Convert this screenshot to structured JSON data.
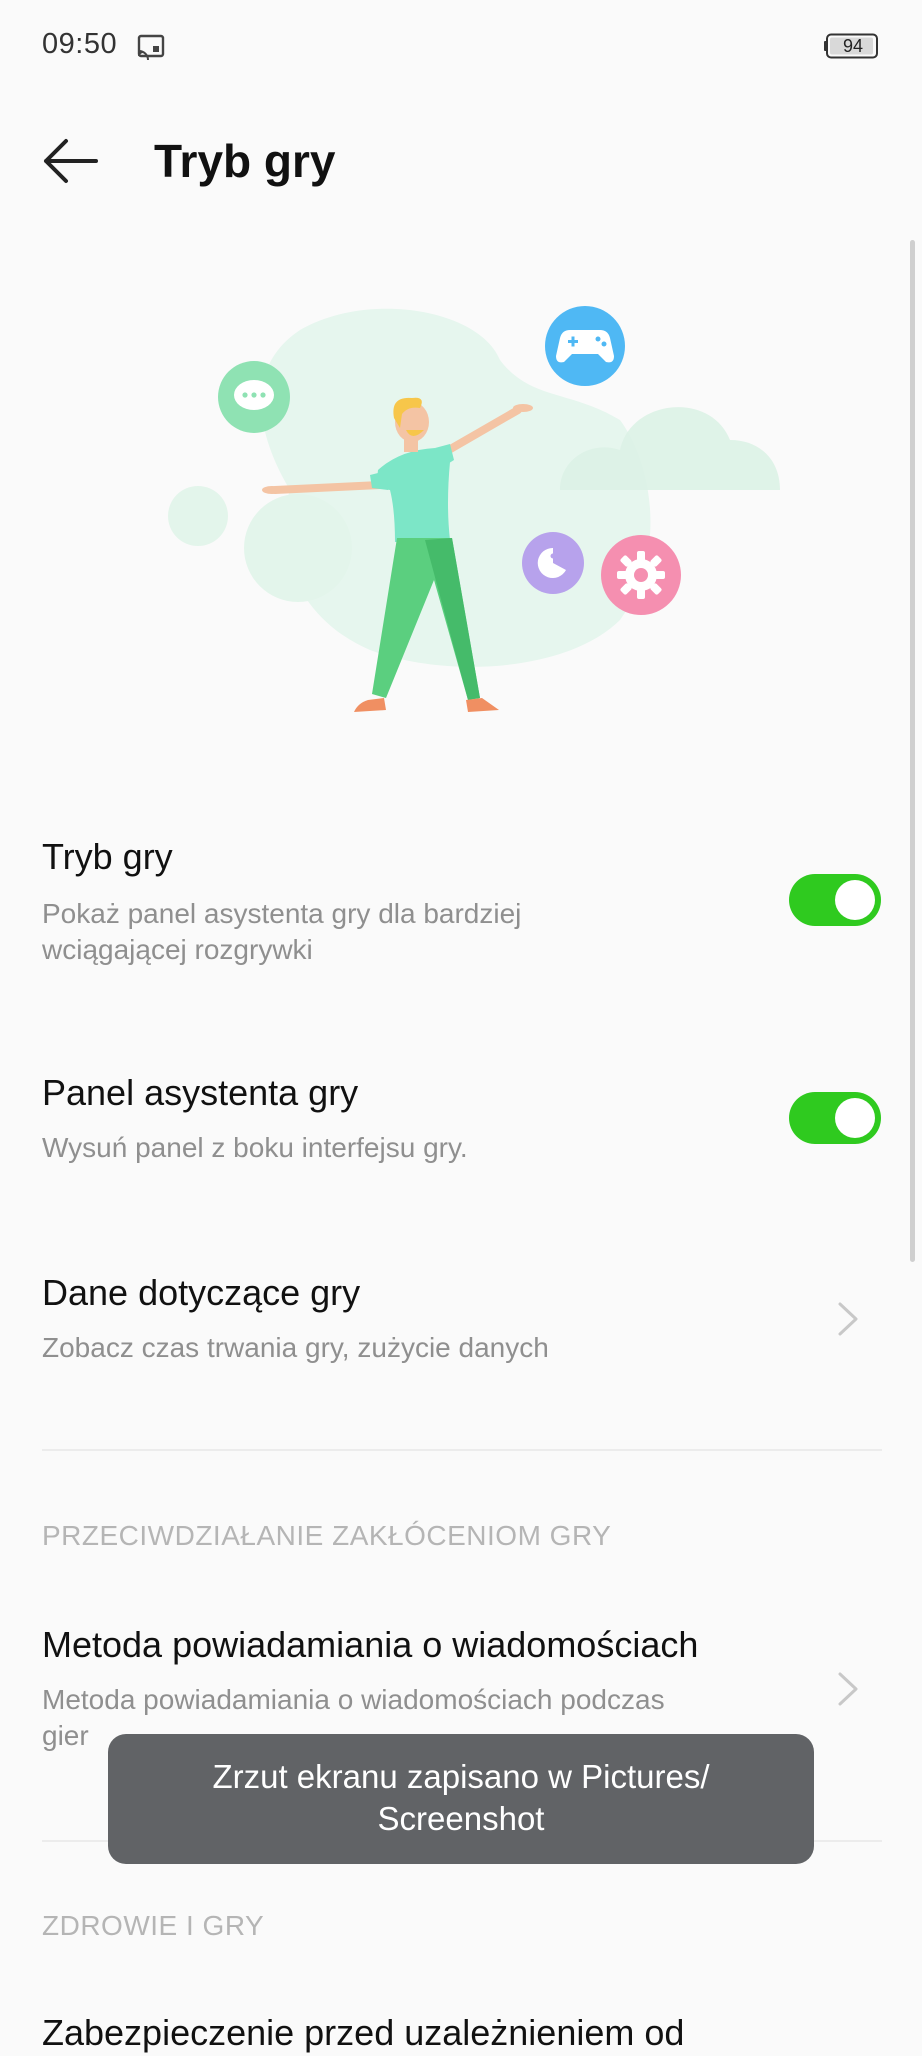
{
  "status_bar": {
    "time": "09:50",
    "cast_icon": "cast-icon",
    "battery_level": "94"
  },
  "header": {
    "title": "Tryb gry",
    "back_icon": "back-arrow-icon"
  },
  "illustration": {
    "name": "game-mode-illustration"
  },
  "settings": {
    "game_mode": {
      "title": "Tryb gry",
      "subtitle_line1": "Pokaż panel asystenta gry dla bardziej",
      "subtitle_line2": "wciągającej rozgrywki",
      "enabled": true
    },
    "assistant_panel": {
      "title": "Panel asystenta gry",
      "subtitle": "Wysuń panel z boku interfejsu gry.",
      "enabled": true
    },
    "game_data": {
      "title": "Dane dotyczące gry",
      "subtitle": "Zobacz czas trwania gry, zużycie danych"
    }
  },
  "sections": {
    "interference": "PRZECIWDZIAŁANIE ZAKŁÓCENIOM GRY",
    "health": "ZDROWIE I GRY"
  },
  "notification_method": {
    "title": "Metoda powiadamiania o wiadomościach",
    "subtitle_line1": "Metoda powiadamiania o wiadomościach podczas",
    "subtitle_line2": "gier"
  },
  "addiction_protection": {
    "title": "Zabezpieczenie przed uzależnieniem od"
  },
  "toast": {
    "line1": "Zrzut ekranu zapisano w  Pictures/",
    "line2": "Screenshot"
  },
  "colors": {
    "toggle_on": "#2fca1f",
    "toast_bg": "#616366",
    "subtitle": "#8f8f8f",
    "section_header": "#b5b5b5"
  }
}
